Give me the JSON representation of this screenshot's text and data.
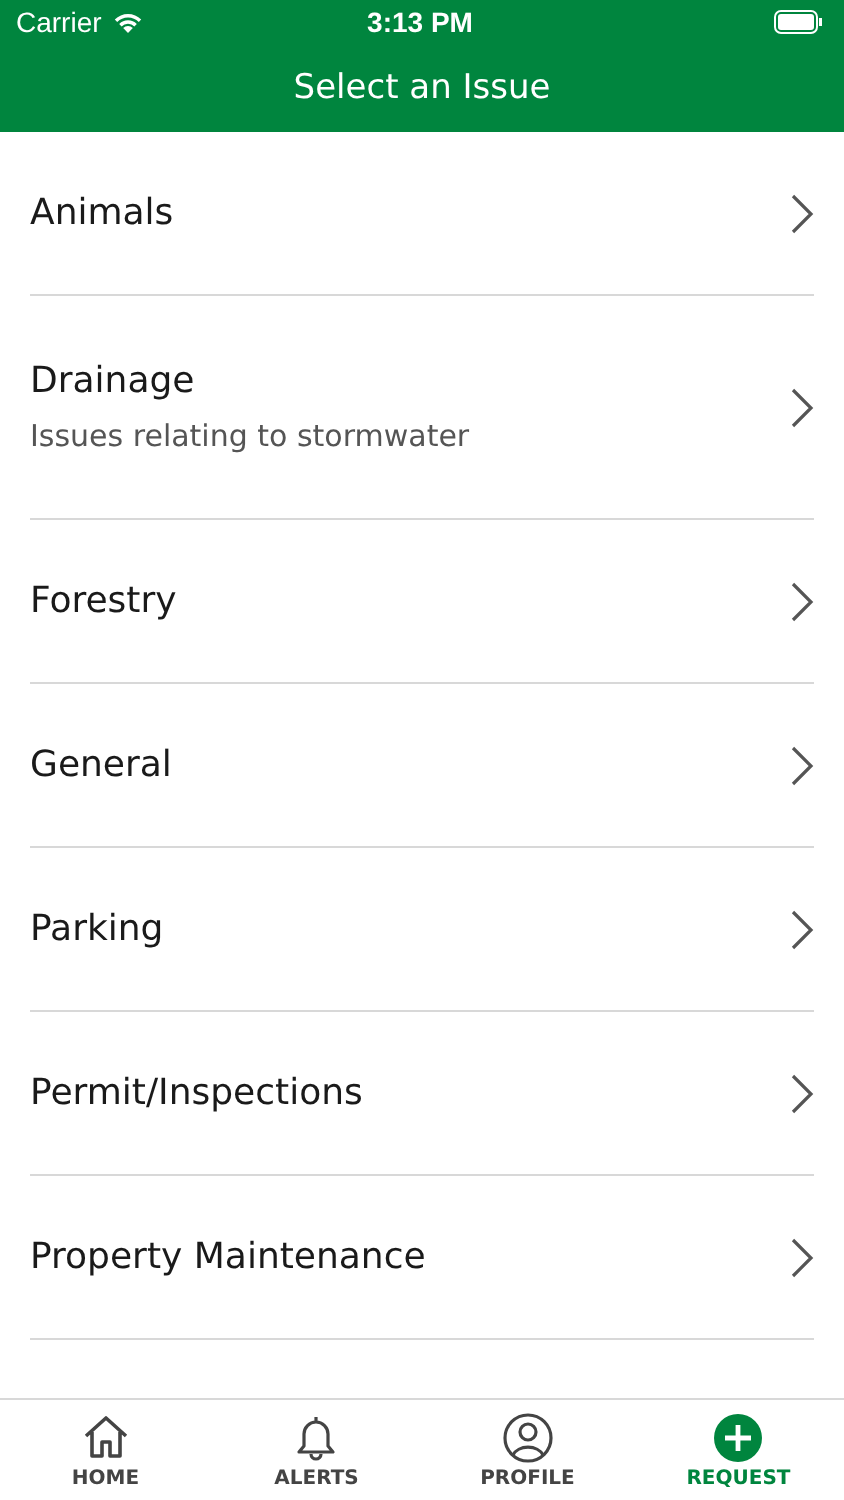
{
  "status_bar": {
    "carrier": "Carrier",
    "time": "3:13 PM"
  },
  "nav_bar": {
    "title": "Select an Issue"
  },
  "issues": [
    {
      "title": "Animals"
    },
    {
      "title": "Drainage",
      "subtitle": "Issues relating to stormwater"
    },
    {
      "title": "Forestry"
    },
    {
      "title": "General"
    },
    {
      "title": "Parking"
    },
    {
      "title": "Permit/Inspections"
    },
    {
      "title": "Property Maintenance"
    }
  ],
  "tab_bar": [
    {
      "kind": "home",
      "label": "HOME",
      "selected": false
    },
    {
      "kind": "bell",
      "label": "ALERTS",
      "selected": false
    },
    {
      "kind": "profile",
      "label": "PROFILE",
      "selected": false
    },
    {
      "kind": "plus",
      "label": "REQUEST",
      "selected": true
    }
  ]
}
